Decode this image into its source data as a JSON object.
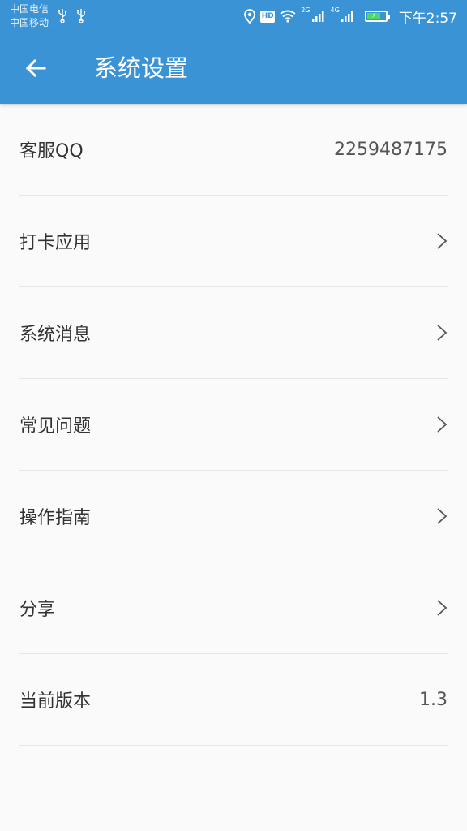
{
  "status_bar": {
    "carrier_1": "中国电信",
    "carrier_2": "中国移动",
    "hd_badge": "HD",
    "net_1": "2G",
    "net_2": "4G",
    "time": "下午2:57",
    "battery_level": 0.75
  },
  "app_bar": {
    "title": "系统设置",
    "back_icon": "arrow-left-icon"
  },
  "settings": [
    {
      "id": "customer-qq",
      "label": "客服QQ",
      "value": "2259487175"
    },
    {
      "id": "checkin-app",
      "label": "打卡应用",
      "icon": "chevron-right-icon"
    },
    {
      "id": "system-messages",
      "label": "系统消息",
      "icon": "chevron-right-icon"
    },
    {
      "id": "faq",
      "label": "常见问题",
      "icon": "chevron-right-icon"
    },
    {
      "id": "guide",
      "label": "操作指南",
      "icon": "chevron-right-icon"
    },
    {
      "id": "share",
      "label": "分享",
      "icon": "chevron-right-icon"
    },
    {
      "id": "version",
      "label": "当前版本",
      "value": "1.3"
    }
  ],
  "colors": {
    "primary": "#3a93d5",
    "background": "#fafafa",
    "divider": "#e6e6e6",
    "text": "#333333"
  }
}
